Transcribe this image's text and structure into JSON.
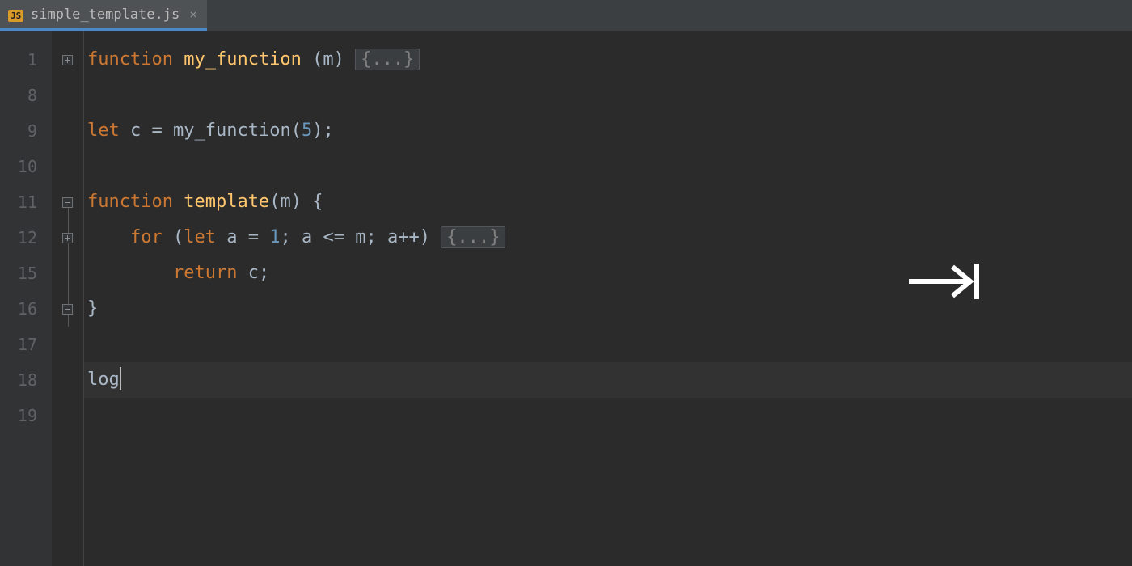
{
  "tab": {
    "filename": "simple_template.js",
    "badge": "JS"
  },
  "gutter": {
    "lines": [
      "1",
      "8",
      "9",
      "10",
      "11",
      "12",
      "15",
      "16",
      "17",
      "18",
      "19"
    ]
  },
  "code": {
    "l1": {
      "kw": "function",
      "sp": " ",
      "fn": "my_function",
      "sp2": " ",
      "paren_o": "(",
      "param": "m",
      "paren_c": ")",
      "sp3": " ",
      "folded": "{...}"
    },
    "l9": {
      "kw": "let",
      "sp": " ",
      "id": "c",
      "sp2": " ",
      "op": "=",
      "sp3": " ",
      "fn": "my_function",
      "po": "(",
      "num": "5",
      "pc": ")",
      "semi": ";"
    },
    "l11": {
      "kw": "function",
      "sp": " ",
      "fn": "template",
      "po": "(",
      "param": "m",
      "pc": ")",
      "sp2": " ",
      "brace": "{"
    },
    "l12": {
      "indent": "    ",
      "kw": "for",
      "sp": " ",
      "po": "(",
      "kw2": "let",
      "sp2": " ",
      "id": "a",
      "sp3": " ",
      "op": "=",
      "sp4": " ",
      "num": "1",
      "semi": ";",
      "sp5": " ",
      "id2": "a",
      "sp6": " ",
      "op2": "<=",
      "sp7": " ",
      "id3": "m",
      "semi2": ";",
      "sp8": " ",
      "id4": "a",
      "op3": "++",
      "pc": ")",
      "sp9": " ",
      "folded": "{...}"
    },
    "l15": {
      "indent": "        ",
      "kw": "return",
      "sp": " ",
      "id": "c",
      "semi": ";"
    },
    "l16": {
      "brace": "}"
    },
    "l18": {
      "id": "log"
    }
  }
}
